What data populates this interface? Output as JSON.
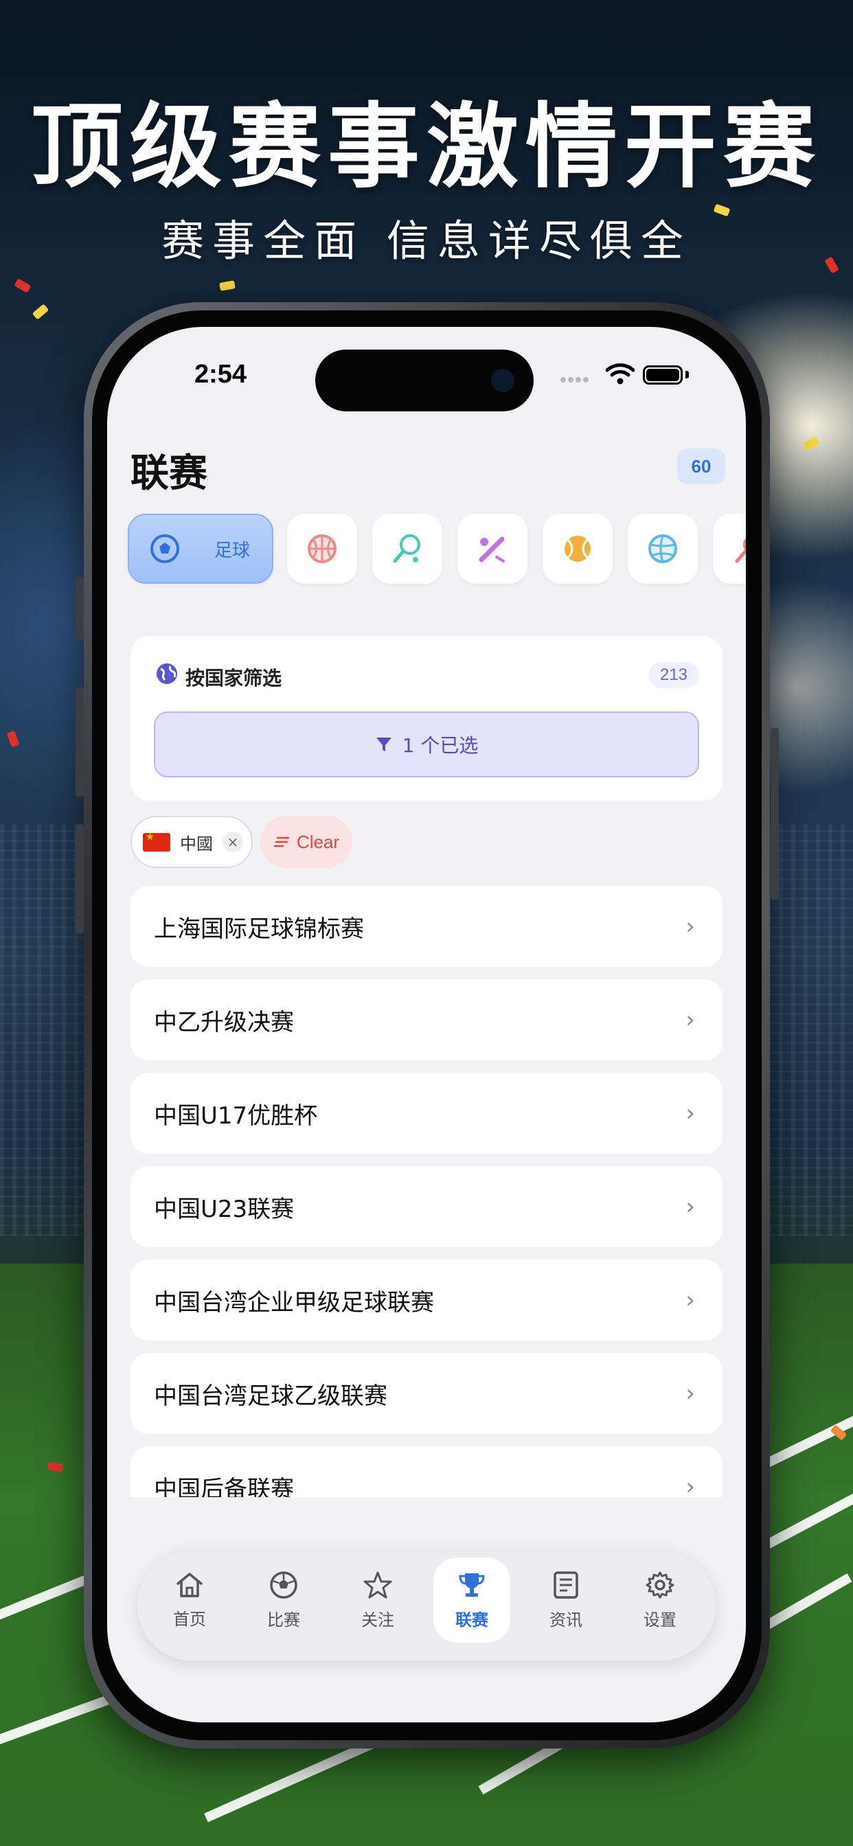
{
  "promo": {
    "headline": "顶级赛事激情开赛",
    "subheadline": "赛事全面 信息详尽俱全"
  },
  "status_bar": {
    "time": "2:54"
  },
  "page": {
    "title": "联赛",
    "count": "60"
  },
  "sports": [
    {
      "name": "soccer-icon",
      "label": "足球",
      "active": true,
      "color": "#2f6fe0"
    },
    {
      "name": "basketball-icon",
      "color": "#ef8a8a"
    },
    {
      "name": "tennis-icon",
      "color": "#48c8b6"
    },
    {
      "name": "baseball-icon",
      "color": "#c66fe0"
    },
    {
      "name": "tennis-ball-icon",
      "color": "#f2b13b"
    },
    {
      "name": "volleyball-icon",
      "color": "#5fb6e8"
    },
    {
      "name": "badminton-icon",
      "color": "#ef7b7b"
    }
  ],
  "filter": {
    "title": "按国家筛选",
    "count": "213",
    "selected_label": "1 个已选"
  },
  "selected_tags": [
    {
      "label": "中國"
    }
  ],
  "clear_label": "Clear",
  "leagues": [
    "上海国际足球锦标赛",
    "中乙升级决赛",
    "中国U17优胜杯",
    "中国U23联赛",
    "中国台湾企业甲级足球联赛",
    "中国台湾足球乙级联赛",
    "中国后备联赛"
  ],
  "tabs": [
    {
      "label": "首页",
      "icon": "home-icon",
      "active": false
    },
    {
      "label": "比赛",
      "icon": "soccer-icon",
      "active": false
    },
    {
      "label": "关注",
      "icon": "star-icon",
      "active": false
    },
    {
      "label": "联赛",
      "icon": "trophy-icon",
      "active": true
    },
    {
      "label": "资讯",
      "icon": "news-icon",
      "active": false
    },
    {
      "label": "设置",
      "icon": "gear-icon",
      "active": false
    }
  ],
  "colors": {
    "accent": "#2f6fe0",
    "filter_accent": "#4f4bc9",
    "clear": "#e0493f"
  }
}
